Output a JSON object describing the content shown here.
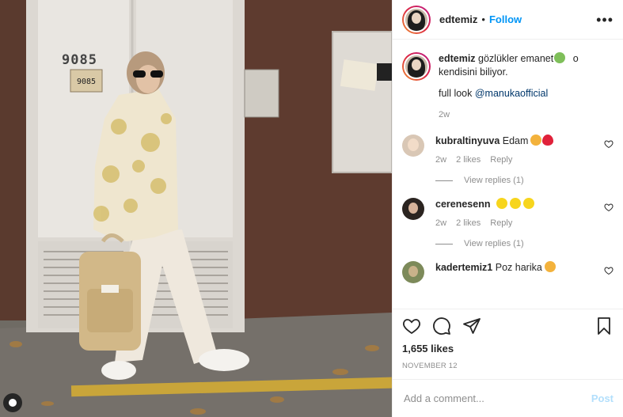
{
  "post": {
    "author": "edtemiz",
    "separator": "•",
    "follow_label": "Follow",
    "more_label": "•••",
    "caption": {
      "username": "edtemiz",
      "text_a": "gözlükler emanet",
      "text_b": "o",
      "text_line2": "kendisini biliyor.",
      "full_look": "full look ",
      "mention": "@manukaofficial",
      "time": "2w"
    },
    "photo": {
      "door_number_big": "9085",
      "door_number_small": "9085"
    },
    "comments": [
      {
        "username": "kubraltinyuva",
        "text": "Edam",
        "time": "2w",
        "likes": "2 likes",
        "reply_label": "Reply",
        "view_replies": "View replies (1)"
      },
      {
        "username": "cerenesenn",
        "text": "",
        "time": "2w",
        "likes": "2 likes",
        "reply_label": "Reply",
        "view_replies": "View replies (1)"
      },
      {
        "username": "kadertemiz1",
        "text": "Poz harika"
      }
    ],
    "likes_count": "1,655 likes",
    "date": "NOVEMBER 12",
    "add_comment_placeholder": "Add a comment...",
    "post_label": "Post"
  },
  "colors": {
    "follow_blue": "#0095f6",
    "post_disabled": "#b2dffc",
    "meta_gray": "#8e8e8e",
    "wall_brown": "#5a3a2e",
    "door_white": "#e9e6e1"
  },
  "icons": {
    "header_more": "more-horizontal-icon",
    "like": "heart-icon",
    "comment": "comment-icon",
    "share": "send-icon",
    "save": "bookmark-icon",
    "alien_emoji": "alien-emoji",
    "heart_eyes_emoji": "heart-eyes-emoji",
    "red_heart_emoji": "red-heart-emoji",
    "yellow_heart_emoji": "yellow-heart-emoji"
  }
}
